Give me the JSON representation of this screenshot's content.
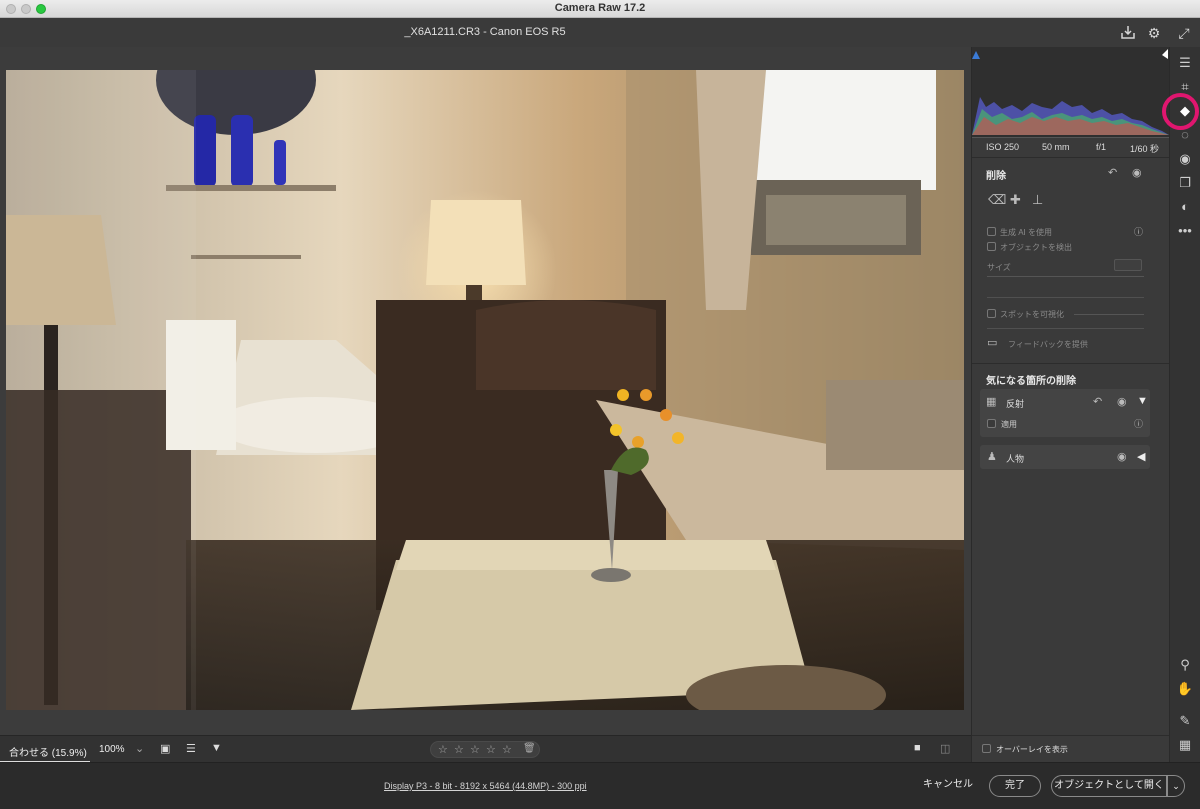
{
  "window": {
    "title": "Camera Raw 17.2"
  },
  "header": {
    "filename": "_X6A1211.CR3  -  Canon EOS R5"
  },
  "histogram": {
    "iso": "ISO 250",
    "focal": "50 mm",
    "aperture": "f/1",
    "shutter": "1/60 秒"
  },
  "remove_panel": {
    "title": "削除",
    "gen_ai_label": "生成 AI を使用",
    "detect_label": "オブジェクトを検出",
    "size_label": "サイズ",
    "spot_label": "スポットを可視化",
    "feedback_label": "フィードバックを提供"
  },
  "distraction_panel": {
    "title": "気になる箇所の削除",
    "reflection_label": "反射",
    "apply_label": "適用",
    "people_label": "人物"
  },
  "overlay": {
    "label": "オーバーレイを表示"
  },
  "bottombar": {
    "zoom_fit": "合わせる (15.9%)",
    "zoom_100": "100%"
  },
  "footer": {
    "info": "Display P3 - 8 bit - 8192 x 5464 (44.8MP) - 300 ppi",
    "cancel": "キャンセル",
    "done": "完了",
    "open_object": "オブジェクトとして開く"
  },
  "colors": {
    "accent_highlight": "#e0166f",
    "panel_bg": "#3a3a3a",
    "canvas_bg": "#3c3c3c"
  }
}
